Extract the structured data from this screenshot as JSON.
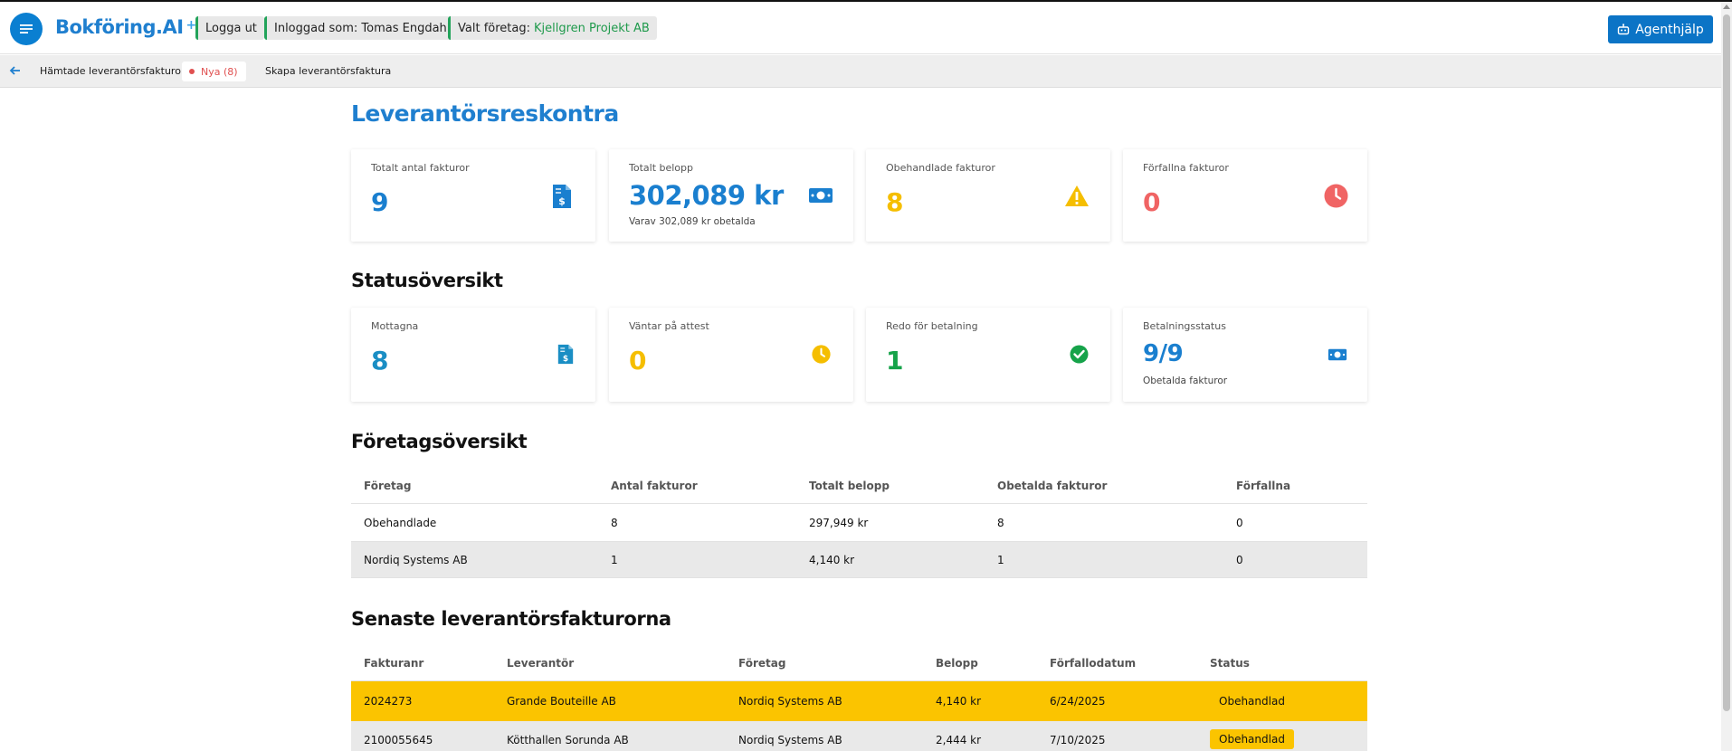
{
  "header": {
    "brand": "Bokföring.AI",
    "brand_plus": "+",
    "logout_label": "Logga ut",
    "logged_in_label": "Inloggad som: Tomas Engdahl",
    "company_prefix": "Valt företag:",
    "company_name": "Kjellgren Projekt AB",
    "agent_help_label": "Agenthjälp"
  },
  "subnav": {
    "fetched_label": "Hämtade leverantörsfakturor",
    "new_badge": "Nya (8)",
    "create_label": "Skapa leverantörsfaktura"
  },
  "page": {
    "title": "Leverantörsreskontra"
  },
  "summary_cards": [
    {
      "label": "Totalt antal fakturor",
      "value": "9",
      "icon": "invoice-dollar-icon",
      "color": "#1a7fcf"
    },
    {
      "label": "Totalt belopp",
      "value": "302,089 kr",
      "sub": "Varav 302,089 kr obetalda",
      "icon": "money-bill-icon",
      "color": "#1a7fcf"
    },
    {
      "label": "Obehandlade fakturor",
      "value": "8",
      "icon": "warning-icon",
      "color": "#f5be00"
    },
    {
      "label": "Förfallna fakturor",
      "value": "0",
      "icon": "clock-icon",
      "color": "#f06464"
    }
  ],
  "status_section": {
    "title": "Statusöversikt",
    "cards": [
      {
        "label": "Mottagna",
        "value": "8",
        "icon": "invoice-dollar-icon",
        "color": "#1a8ec4"
      },
      {
        "label": "Väntar på attest",
        "value": "0",
        "icon": "clock-icon",
        "color": "#f5be00"
      },
      {
        "label": "Redo för betalning",
        "value": "1",
        "icon": "check-circle-icon",
        "color": "#16a34a"
      },
      {
        "label": "Betalningsstatus",
        "value": "9/9",
        "sub": "Obetalda fakturor",
        "icon": "money-bill-icon",
        "color": "#1a7fcf"
      }
    ]
  },
  "company_overview": {
    "title": "Företagsöversikt",
    "columns": [
      "Företag",
      "Antal fakturor",
      "Totalt belopp",
      "Obetalda fakturor",
      "Förfallna"
    ],
    "rows": [
      [
        "Obehandlade",
        "8",
        "297,949 kr",
        "8",
        "0"
      ],
      [
        "Nordiq Systems AB",
        "1",
        "4,140 kr",
        "1",
        "0"
      ]
    ]
  },
  "recent_invoices": {
    "title": "Senaste leverantörsfakturorna",
    "columns": [
      "Fakturanr",
      "Leverantör",
      "Företag",
      "Belopp",
      "Förfallodatum",
      "Status"
    ],
    "rows": [
      [
        "2024273",
        "Grande Bouteille AB",
        "Nordiq Systems AB",
        "4,140 kr",
        "6/24/2025",
        "Obehandlad"
      ],
      [
        "2100055645",
        "Kötthallen Sorunda AB",
        "Nordiq Systems AB",
        "2,444 kr",
        "7/10/2025",
        "Obehandlad"
      ]
    ]
  },
  "colors": {
    "primary": "#0b74c6",
    "brand": "#1f7fcf",
    "highlight_row": "#fbc400",
    "alt_row": "#e9e9e9",
    "status_tag": "#fbc400"
  }
}
